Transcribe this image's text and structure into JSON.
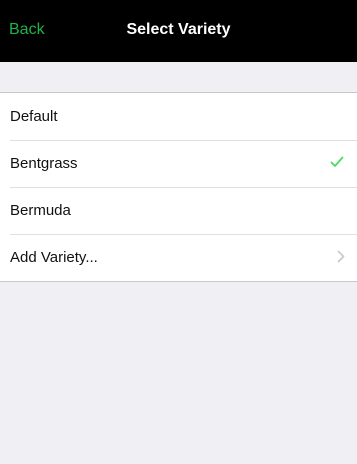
{
  "navbar": {
    "back_label": "Back",
    "title": "Select Variety"
  },
  "list": {
    "items": [
      {
        "label": "Default",
        "accessory": "none"
      },
      {
        "label": "Bentgrass",
        "accessory": "checkmark-icon",
        "selected": true
      },
      {
        "label": "Bermuda",
        "accessory": "none"
      },
      {
        "label": "Add Variety...",
        "accessory": "chevron-right-icon"
      }
    ]
  },
  "colors": {
    "navbar_background": "#000000",
    "accent_green": "#1fb24a",
    "page_background": "#efeff4",
    "checkmark": "#4cd964",
    "chevron": "#c7c7cc"
  }
}
